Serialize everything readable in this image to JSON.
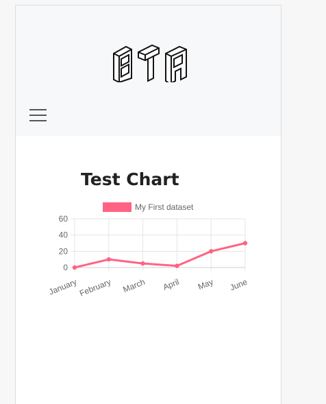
{
  "header": {
    "logo_text": "BTA",
    "menu_icon": "hamburger-menu-icon"
  },
  "main": {
    "heading": "Test Chart"
  },
  "colors": {
    "series": "#ff6384",
    "grid": "#e5e5e5",
    "header_bg": "#f6f8fa"
  },
  "chart_data": {
    "type": "line",
    "categories": [
      "January",
      "February",
      "March",
      "April",
      "May",
      "June"
    ],
    "series": [
      {
        "name": "My First dataset",
        "values": [
          0,
          10,
          5,
          2,
          20,
          30
        ],
        "color": "#ff6384"
      }
    ],
    "title": "",
    "xlabel": "",
    "ylabel": "",
    "ylim": [
      0,
      60
    ],
    "yticks": [
      0,
      20,
      40,
      60
    ],
    "grid": true,
    "legend": "top"
  }
}
